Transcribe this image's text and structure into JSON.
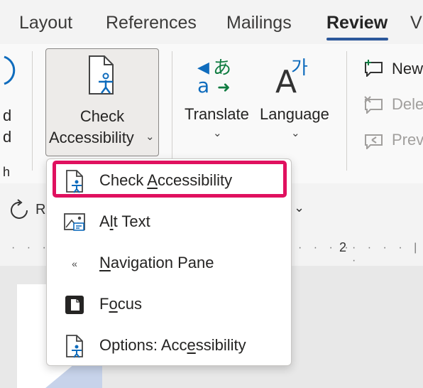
{
  "tabs": [
    {
      "label": "Layout"
    },
    {
      "label": "References"
    },
    {
      "label": "Mailings"
    },
    {
      "label": "Review"
    },
    {
      "label": "V"
    }
  ],
  "ribbon": {
    "left_cut_top": "d",
    "left_cut_mid": "d",
    "left_cut_bottom": "h",
    "check_line1": "Check",
    "check_line2": "Accessibility",
    "translate_label": "Translate",
    "language_label": "Language",
    "new_comment": "New",
    "delete_comment": "Dele",
    "previous_comment": "Prev"
  },
  "toolbar2": {
    "cut_label": "R"
  },
  "ruler": {
    "mark": "2"
  },
  "menu": {
    "items": [
      {
        "pre": "Check ",
        "key": "A",
        "post": "ccessibility",
        "icon": "check-accessibility-icon"
      },
      {
        "pre": "A",
        "key": "l",
        "post": "t Text",
        "icon": "alt-text-icon"
      },
      {
        "pre": "",
        "key": "N",
        "post": "avigation Pane",
        "icon": "double-chevron-icon"
      },
      {
        "pre": "F",
        "key": "o",
        "post": "cus",
        "icon": "focus-icon"
      },
      {
        "pre": "Options: Acc",
        "key": "e",
        "post": "ssibility",
        "icon": "options-accessibility-icon"
      }
    ]
  },
  "colors": {
    "accent": "#2b579a",
    "highlight": "#e0115f",
    "icon_blue": "#0f6cbd"
  }
}
